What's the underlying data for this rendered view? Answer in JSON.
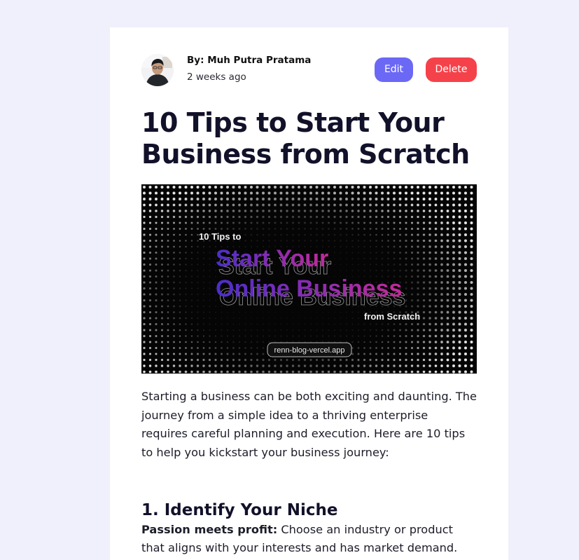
{
  "post": {
    "author": "By: Muh Putra Pratama",
    "date": "2 weeks ago",
    "edit_label": "Edit",
    "delete_label": "Delete",
    "title": "10 Tips to Start Your Business from Scratch",
    "hero": {
      "small_top": "10 Tips to",
      "line1": "Start Your",
      "line2": "Online Business",
      "small_bottom": "from Scratch",
      "url_pill": "renn-blog-vercel.app"
    },
    "intro": "Starting a business can be both exciting and daunting. The journey from a simple idea to a thriving enterprise requires careful planning and execution. Here are 10 tips to help you kickstart your business journey:",
    "tips": [
      {
        "heading": "1. Identify Your Niche",
        "lead": "Passion meets profit:",
        "text": " Choose an industry or product that aligns with your interests and has market demand."
      }
    ]
  },
  "colors": {
    "page_bg": "#eff0fb",
    "edit_button": "#6c68f6",
    "delete_button": "#f5424a",
    "hero_gradient_start": "#4b2ec9",
    "hero_gradient_end": "#c42a9a"
  },
  "icons": {
    "avatar": "author-avatar"
  }
}
